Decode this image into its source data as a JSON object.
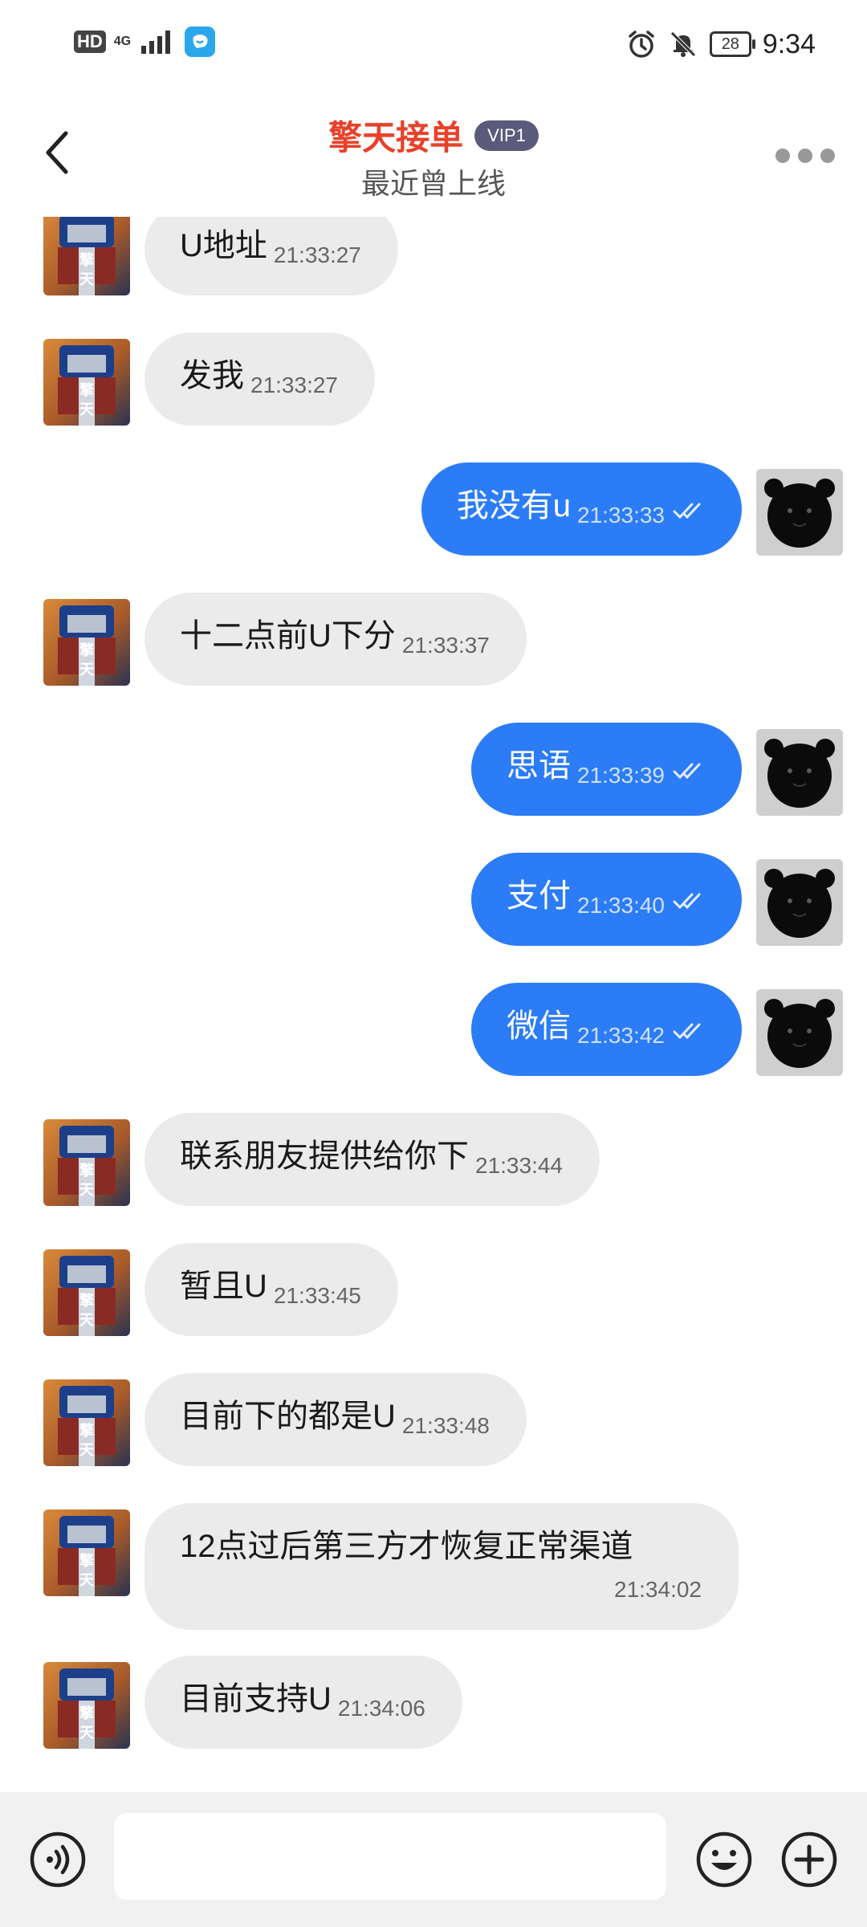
{
  "status_bar": {
    "network_hd": "HD",
    "network_type": "4G",
    "battery": "28",
    "time": "9:34"
  },
  "header": {
    "title": "擎天接单",
    "badge": "VIP1",
    "subtitle": "最近曾上线"
  },
  "messages": [
    {
      "side": "in",
      "text": "U地址",
      "time": "21:33:27"
    },
    {
      "side": "in",
      "text": "发我",
      "time": "21:33:27"
    },
    {
      "side": "out",
      "text": "我没有u",
      "time": "21:33:33",
      "read": true
    },
    {
      "side": "in",
      "text": "十二点前U下分",
      "time": "21:33:37"
    },
    {
      "side": "out",
      "text": "思语",
      "time": "21:33:39",
      "read": true
    },
    {
      "side": "out",
      "text": "支付",
      "time": "21:33:40",
      "read": true
    },
    {
      "side": "out",
      "text": "微信",
      "time": "21:33:42",
      "read": true
    },
    {
      "side": "in",
      "text": "联系朋友提供给你下",
      "time": "21:33:44"
    },
    {
      "side": "in",
      "text": "暂且U",
      "time": "21:33:45"
    },
    {
      "side": "in",
      "text": "目前下的都是U",
      "time": "21:33:48"
    },
    {
      "side": "in",
      "text": "12点过后第三方才恢复正常渠道",
      "time": "21:34:02"
    },
    {
      "side": "in",
      "text": "目前支持U",
      "time": "21:34:06"
    }
  ],
  "input": {
    "value": "",
    "placeholder": ""
  },
  "colors": {
    "outgoing_bubble": "#2b7cf6",
    "incoming_bubble": "#ebebeb",
    "title": "#e8412b"
  },
  "icons": {
    "back": "chevron-left-icon",
    "more": "more-dots-icon",
    "voice": "voice-icon",
    "emoji": "emoji-icon",
    "plus": "plus-icon"
  }
}
